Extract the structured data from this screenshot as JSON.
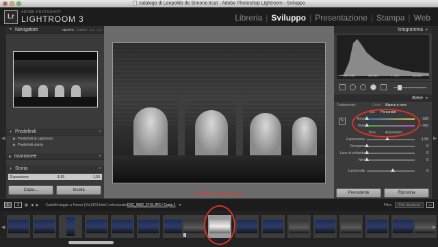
{
  "window": {
    "title": "catalogo di Leopoldo de Simone.lrcat - Adobe Photoshop Lightroom - Sviluppo"
  },
  "app": {
    "badge": "Lr",
    "vendor": "ADOBE PHOTOSHOP",
    "name": "LIGHTROOM 3"
  },
  "modules": [
    "Libreria",
    "Sviluppo",
    "Presentazione",
    "Stampa",
    "Web"
  ],
  "left": {
    "navigator": {
      "title": "Navigatore",
      "zooms": [
        "ADATTA",
        "RIEMPI",
        "1:1",
        "1:1"
      ]
    },
    "presets": {
      "title": "Predefiniti",
      "items": [
        "Predefiniti di Lightroom",
        "Predefiniti utente"
      ]
    },
    "snapshots": {
      "title": "Istantanee"
    },
    "history": {
      "title": "Storia",
      "row": {
        "label": "Esposizione",
        "v1": "-1,55",
        "v2": "-1,55"
      }
    },
    "buttons": {
      "copy": "Copia...",
      "paste": "Incolla"
    }
  },
  "center": {
    "caption": "modifico copia virtuale"
  },
  "right": {
    "histogram": {
      "title": "Istogramma",
      "iso": "ISO 640",
      "focal": "62 mm",
      "aperture": "f / 4,5",
      "shutter": "0,5 sec"
    },
    "basic": {
      "title": "Base",
      "treatment_label": "Trattamento:",
      "treatment_color": "Colori",
      "treatment_bw": "Bianco e nero",
      "bw_label": "BB:",
      "bw_value": "Personale",
      "temp_label": "Temp",
      "temp_value": "−100",
      "tint_label": "Tinta",
      "tint_value": "−100",
      "tone_label": "Tono",
      "tone_auto": "Automatico",
      "sliders": [
        {
          "label": "Esposizione",
          "value": "-1,55"
        },
        {
          "label": "Recupero",
          "value": "0"
        },
        {
          "label": "Luce di schiarita",
          "value": "0"
        },
        {
          "label": "Neri",
          "value": "0"
        }
      ],
      "brightness": {
        "label": "Luminosità",
        "value": "0"
      }
    },
    "buttons": {
      "previous": "Precedente",
      "reset": "Ripristina"
    }
  },
  "filmstrip_bar": {
    "screen1": "1",
    "screen2": "2",
    "path": "Cartelle/viaggio a Parma (Vivi)/163 foto/1 selezionata/",
    "filename": "DSC_5662_3719.JPG / Copia 1",
    "filter_label": "Filtro:",
    "filter_value": "Filtri disattivati"
  },
  "filmstrip": {
    "selected_badge": "2"
  }
}
